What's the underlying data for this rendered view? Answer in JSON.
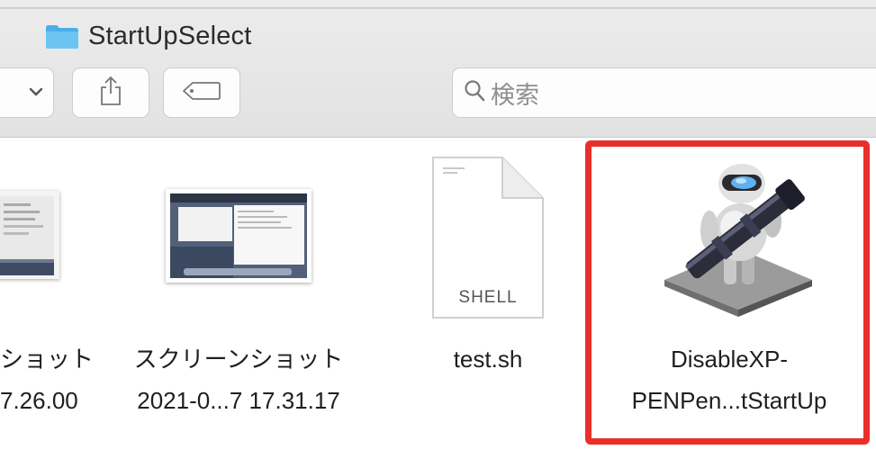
{
  "window": {
    "title": "StartUpSelect"
  },
  "toolbar": {
    "search_placeholder": "検索"
  },
  "files": [
    {
      "name_line1": "ショット",
      "name_line2": "7.26.00",
      "type": "screenshot"
    },
    {
      "name_line1": "スクリーンショット",
      "name_line2": "2021-0...7 17.31.17",
      "type": "screenshot"
    },
    {
      "name_line1": "test.sh",
      "name_line2": "",
      "type": "shell-script",
      "badge": "SHELL"
    },
    {
      "name_line1": "DisableXP-",
      "name_line2": "PENPen...tStartUp",
      "type": "automator-app",
      "selected": true
    }
  ],
  "colors": {
    "highlight": "#e8302a",
    "folder": "#5ab8ef"
  }
}
